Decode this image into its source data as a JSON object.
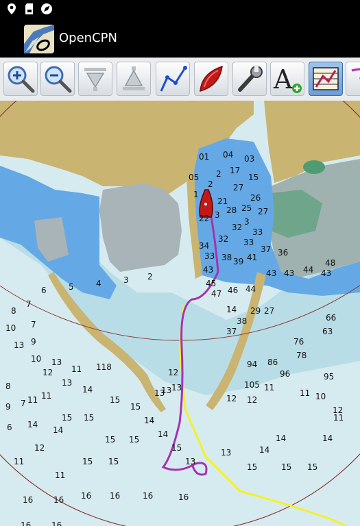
{
  "status_bar": {
    "icons": [
      "location-pin-icon",
      "sd-card-icon",
      "navigation-compass-icon"
    ]
  },
  "app_bar": {
    "title": "OpenCPN",
    "logo_icon": "opencpn-logo-icon"
  },
  "toolbar": {
    "tools": [
      {
        "name": "zoom-in",
        "icon": "zoom-in-icon"
      },
      {
        "name": "zoom-out",
        "icon": "zoom-out-icon"
      },
      {
        "name": "scale-down",
        "icon": "scale-down-icon"
      },
      {
        "name": "scale-up",
        "icon": "scale-up-icon"
      },
      {
        "name": "route",
        "icon": "route-icon"
      },
      {
        "name": "ship",
        "icon": "ship-icon"
      },
      {
        "name": "settings",
        "icon": "wrench-icon"
      },
      {
        "name": "text",
        "icon": "text-plus-icon"
      },
      {
        "name": "chart-quilt",
        "icon": "chart-quilt-icon",
        "active": true
      },
      {
        "name": "track",
        "icon": "track-icon"
      }
    ]
  },
  "colors": {
    "land": "#c9b471",
    "built_area": "#a9b4b8",
    "deep_water": "#d6ebef",
    "mid_water": "#b9dde6",
    "shallow_water": "#64a9e6",
    "track": "#a632b0",
    "route": "#f5f02a",
    "vessel": "#c21818",
    "range_ring": "#8b3a3a"
  },
  "soundings": [
    {
      "v": "01"
    },
    {
      "v": "04"
    },
    {
      "v": "03"
    },
    {
      "v": "2"
    },
    {
      "v": "17"
    },
    {
      "v": "15"
    },
    {
      "v": "05"
    },
    {
      "v": "2"
    },
    {
      "v": "27"
    },
    {
      "v": "26"
    },
    {
      "v": "1"
    },
    {
      "v": "21"
    },
    {
      "v": "25"
    },
    {
      "v": "28"
    },
    {
      "v": "3"
    },
    {
      "v": "27"
    },
    {
      "v": "22"
    },
    {
      "v": "3"
    },
    {
      "v": "32"
    },
    {
      "v": "33"
    },
    {
      "v": "32"
    },
    {
      "v": "33"
    },
    {
      "v": "34"
    },
    {
      "v": "37"
    },
    {
      "v": "36"
    },
    {
      "v": "33"
    },
    {
      "v": "38"
    },
    {
      "v": "39"
    },
    {
      "v": "41"
    },
    {
      "v": "43"
    },
    {
      "v": "43"
    },
    {
      "v": "44"
    },
    {
      "v": "43"
    },
    {
      "v": "45"
    },
    {
      "v": "47"
    },
    {
      "v": "46"
    },
    {
      "v": "44"
    },
    {
      "v": "43"
    },
    {
      "v": "48"
    },
    {
      "v": "14"
    },
    {
      "v": "38"
    },
    {
      "v": "37"
    },
    {
      "v": "29"
    },
    {
      "v": "27"
    },
    {
      "v": "66"
    },
    {
      "v": "63"
    },
    {
      "v": "76"
    },
    {
      "v": "78"
    },
    {
      "v": "94"
    },
    {
      "v": "86"
    },
    {
      "v": "96"
    },
    {
      "v": "95"
    },
    {
      "v": "105"
    },
    {
      "v": "11"
    },
    {
      "v": "11"
    },
    {
      "v": "10"
    },
    {
      "v": "11"
    },
    {
      "v": "12"
    },
    {
      "v": "12"
    },
    {
      "v": "12"
    },
    {
      "v": "13"
    },
    {
      "v": "13"
    },
    {
      "v": "14"
    },
    {
      "v": "14"
    },
    {
      "v": "14"
    },
    {
      "v": "14"
    },
    {
      "v": "14"
    },
    {
      "v": "13"
    },
    {
      "v": "15"
    },
    {
      "v": "15"
    },
    {
      "v": "15"
    },
    {
      "v": "15"
    },
    {
      "v": "15"
    },
    {
      "v": "15"
    },
    {
      "v": "15"
    },
    {
      "v": "15"
    },
    {
      "v": "15"
    },
    {
      "v": "16"
    },
    {
      "v": "16"
    },
    {
      "v": "16"
    },
    {
      "v": "16"
    },
    {
      "v": "16"
    },
    {
      "v": "16"
    },
    {
      "v": "16"
    },
    {
      "v": "16"
    },
    {
      "v": "12"
    },
    {
      "v": "13"
    },
    {
      "v": "11"
    },
    {
      "v": "118"
    },
    {
      "v": "11"
    },
    {
      "v": "10"
    },
    {
      "v": "13"
    },
    {
      "v": "13"
    },
    {
      "v": "9"
    },
    {
      "v": "10"
    },
    {
      "v": "7"
    },
    {
      "v": "8"
    },
    {
      "v": "7"
    },
    {
      "v": "6"
    },
    {
      "v": "5"
    },
    {
      "v": "4"
    },
    {
      "v": "3"
    },
    {
      "v": "2"
    },
    {
      "v": "8"
    },
    {
      "v": "9"
    },
    {
      "v": "7"
    },
    {
      "v": "6"
    },
    {
      "v": "11"
    },
    {
      "v": "12"
    },
    {
      "v": "13"
    },
    {
      "v": "14"
    },
    {
      "v": "15"
    },
    {
      "v": "15"
    },
    {
      "v": "14"
    },
    {
      "v": "14"
    },
    {
      "v": "15"
    },
    {
      "v": "13"
    },
    {
      "v": "12"
    },
    {
      "v": "11"
    },
    {
      "v": "11"
    }
  ]
}
